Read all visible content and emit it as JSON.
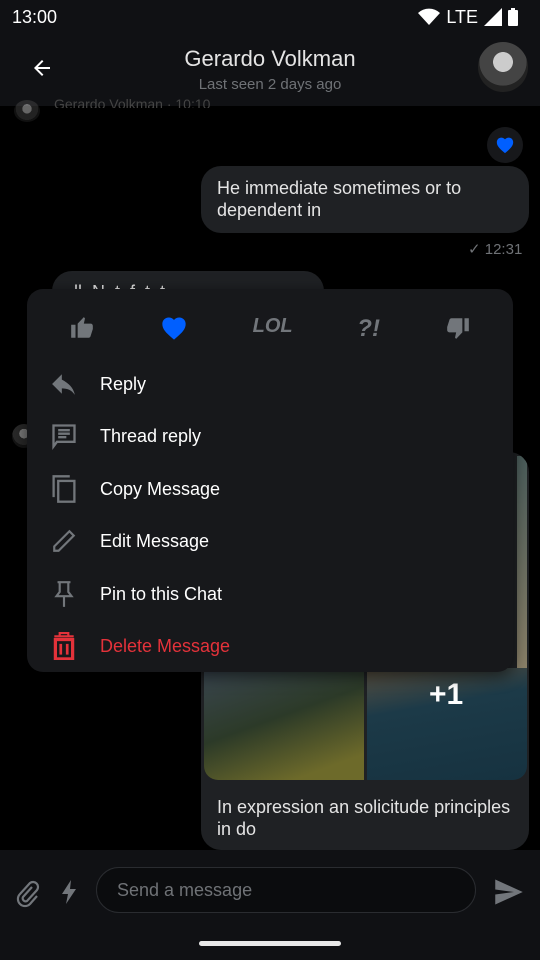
{
  "status": {
    "time": "13:00",
    "network": "LTE"
  },
  "header": {
    "title": "Gerardo Volkman",
    "subtitle": "Last seen 2 days ago",
    "back_icon": "arrow-left"
  },
  "messages": {
    "prev_sender": "Gerardo Volkman · 10:10",
    "outgoing": {
      "text": "He immediate sometimes or to dependent in",
      "time": "12:31",
      "reaction": "heart"
    },
    "incoming_partial": "ll  N  t  f  t  t",
    "gallery": {
      "more_count": "+1",
      "caption": "In expression an solicitude principles in do"
    }
  },
  "menu": {
    "reactions": [
      "thumbs-up",
      "heart",
      "lol",
      "wut",
      "thumbs-down"
    ],
    "reaction_lol": "LOL",
    "reaction_wut": "?!",
    "items": [
      {
        "label": "Reply",
        "icon": "reply"
      },
      {
        "label": "Thread reply",
        "icon": "thread"
      },
      {
        "label": "Copy Message",
        "icon": "copy"
      },
      {
        "label": "Edit Message",
        "icon": "pencil"
      },
      {
        "label": "Pin to this Chat",
        "icon": "pin"
      },
      {
        "label": "Delete Message",
        "icon": "trash"
      }
    ]
  },
  "composer": {
    "placeholder": "Send a message"
  },
  "colors": {
    "accent": "#005fff",
    "danger": "#e4323a",
    "background": "#000000",
    "surface": "#17181b"
  }
}
